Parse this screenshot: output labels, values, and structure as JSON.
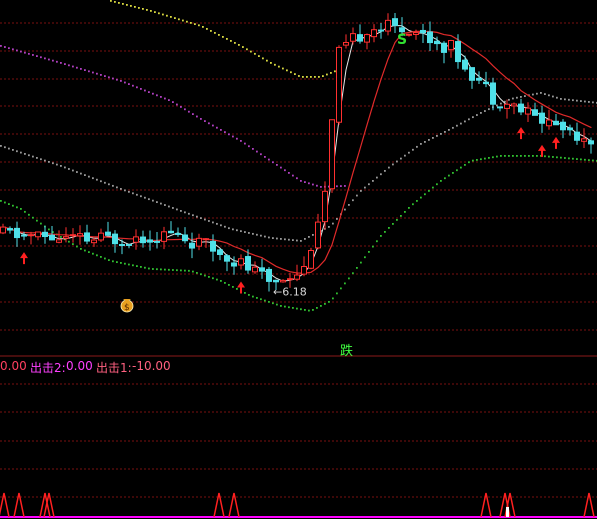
{
  "colors": {
    "background": "#000000",
    "grid": "#7a1010",
    "divider": "#8b1a1a",
    "candle_up": "#ff3030",
    "candle_down": "#4fe0e8",
    "ma_white": "#e8e8e8",
    "ma_red": "#e02a2a",
    "dots_yellow": "#d8d840",
    "dots_magenta": "#b040c0",
    "dots_gray": "#9a9a9a",
    "dots_green": "#30c030",
    "signal_arrow": "#ff2020",
    "bottom_signal": "#ff2020",
    "bottom_baseline": "#ff00ff",
    "label_red": "#ff4060",
    "label_magenta": "#ff40ff",
    "label_pink": "#ff6080",
    "label_die": "#40ff40"
  },
  "annotations": {
    "low_marker": "←6.18",
    "die_label": "跌",
    "s_label": "S",
    "money_icon": "money-bag-icon"
  },
  "indicator_labels": {
    "first_value": "0.00",
    "chuji2_label": "出击2:",
    "chuji2_value": "0.00",
    "chuji1_label": "出击1:",
    "chuji1_value": "-10.00"
  },
  "chart_data": {
    "type": "candlestick",
    "price_range": [
      5.9,
      8.3
    ],
    "low_price_label": 6.18,
    "signal_arrow_candles": [
      3,
      34,
      74,
      77,
      79
    ],
    "bottom_spike_candles": [
      0,
      2,
      6,
      7,
      30,
      32,
      67,
      69,
      70,
      81
    ]
  }
}
